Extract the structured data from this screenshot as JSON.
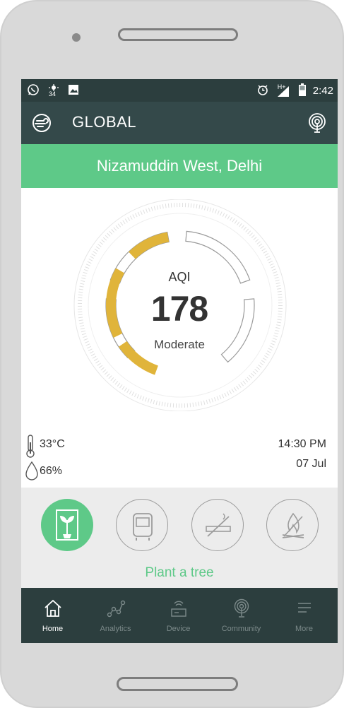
{
  "statusbar": {
    "left_icons": [
      "whatsapp-icon",
      "weather-icon",
      "image-icon"
    ],
    "weather_temp": "34",
    "network": "H+",
    "time": "2:42"
  },
  "appbar": {
    "title": "GLOBAL",
    "left_icon": "globe-icon",
    "right_icon": "radar-icon"
  },
  "location": "Nizamuddin West, Delhi",
  "aqi": {
    "label": "AQI",
    "value": "178",
    "status": "Moderate",
    "level": 0.45,
    "accent": "#e0b43a"
  },
  "weather": {
    "temperature": "33°C",
    "humidity": "66%"
  },
  "datetime": {
    "time": "14:30 PM",
    "date": "07 Jul"
  },
  "actions": {
    "items": [
      {
        "icon": "plant-icon",
        "active": true
      },
      {
        "icon": "bus-icon",
        "active": false
      },
      {
        "icon": "no-smoking-icon",
        "active": false
      },
      {
        "icon": "no-fire-icon",
        "active": false
      }
    ],
    "caption": "Plant a tree"
  },
  "nav": {
    "items": [
      {
        "label": "Home",
        "icon": "home-icon",
        "active": true
      },
      {
        "label": "Analytics",
        "icon": "analytics-icon",
        "active": false
      },
      {
        "label": "Device",
        "icon": "device-icon",
        "active": false
      },
      {
        "label": "Community",
        "icon": "community-icon",
        "active": false
      },
      {
        "label": "More",
        "icon": "more-icon",
        "active": false
      }
    ]
  },
  "colors": {
    "primary_dark": "#34494a",
    "status_dark": "#2c3e3e",
    "green": "#5ec988",
    "gauge_yellow": "#e0b43a"
  }
}
